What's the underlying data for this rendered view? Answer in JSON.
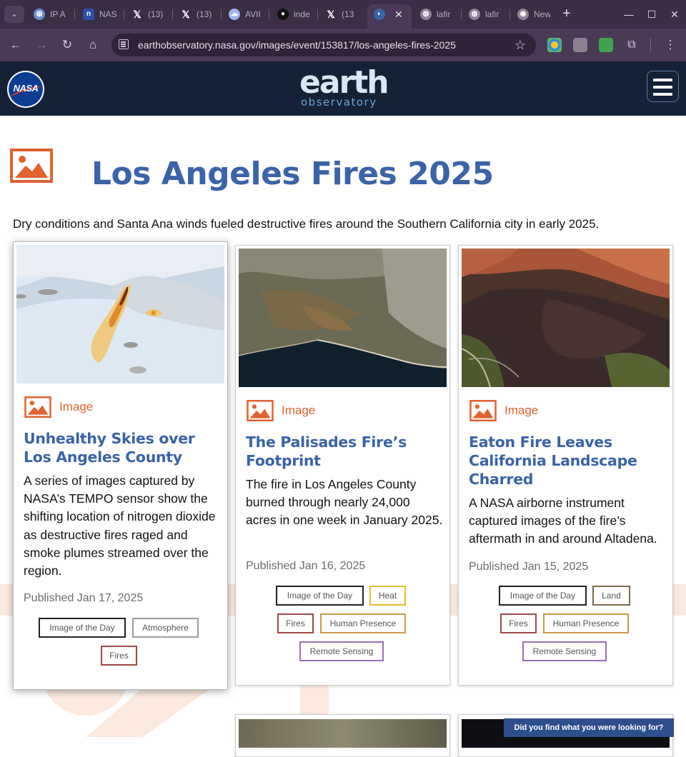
{
  "browser": {
    "tabs": [
      {
        "title": "IP A",
        "icon": "globe-icon"
      },
      {
        "title": "NAS",
        "icon": "nasa-icon"
      },
      {
        "title": "(13)",
        "icon": "x-icon"
      },
      {
        "title": "(13)",
        "icon": "x-icon"
      },
      {
        "title": "AVII",
        "icon": "cloud-icon"
      },
      {
        "title": "inde",
        "icon": "github-icon"
      },
      {
        "title": "(13",
        "icon": "x-icon"
      },
      {
        "title": "",
        "icon": "earth-observatory-icon",
        "active": true
      },
      {
        "title": "lafir",
        "icon": "globe-icon"
      },
      {
        "title": "lafir",
        "icon": "globe-icon"
      },
      {
        "title": "New",
        "icon": "chrome-icon"
      }
    ],
    "url": "earthobservatory.nasa.gov/images/event/153817/los-angeles-fires-2025"
  },
  "site": {
    "logo_word": "NASA",
    "brand_big": "earth",
    "brand_small": "observatory"
  },
  "page": {
    "title": "Los Angeles Fires 2025",
    "description": "Dry conditions and Santa Ana winds fueled destructive fires around the Southern California city in early 2025."
  },
  "cards": [
    {
      "type": "Image",
      "title": "Unhealthy Skies over Los Angeles County",
      "description": "A series of images captured by NASA’s TEMPO sensor show the shifting location of nitrogen dioxide as destructive fires raged and smoke plumes streamed over the region.",
      "date": "Published Jan 17, 2025",
      "tags": [
        "Image of the Day",
        "Atmosphere",
        "Fires"
      ]
    },
    {
      "type": "Image",
      "title": "The Palisades Fire’s Footprint",
      "description": "The fire in Los Angeles County burned through nearly 24,000 acres in one week in January 2025.",
      "date": "Published Jan 16, 2025",
      "tags": [
        "Image of the Day",
        "Heat",
        "Fires",
        "Human Presence",
        "Remote Sensing"
      ]
    },
    {
      "type": "Image",
      "title": "Eaton Fire Leaves California Landscape Charred",
      "description": "A NASA airborne instrument captured images of the fire’s aftermath in and around Altadena.",
      "date": "Published Jan 15, 2025",
      "tags": [
        "Image of the Day",
        "Land",
        "Fires",
        "Human Presence",
        "Remote Sensing"
      ]
    }
  ],
  "feedback_label": "Did you find what you were looking for?",
  "colors": {
    "accent_orange": "#e0622e",
    "title_blue": "#3a63a8",
    "header_navy": "#142136"
  }
}
